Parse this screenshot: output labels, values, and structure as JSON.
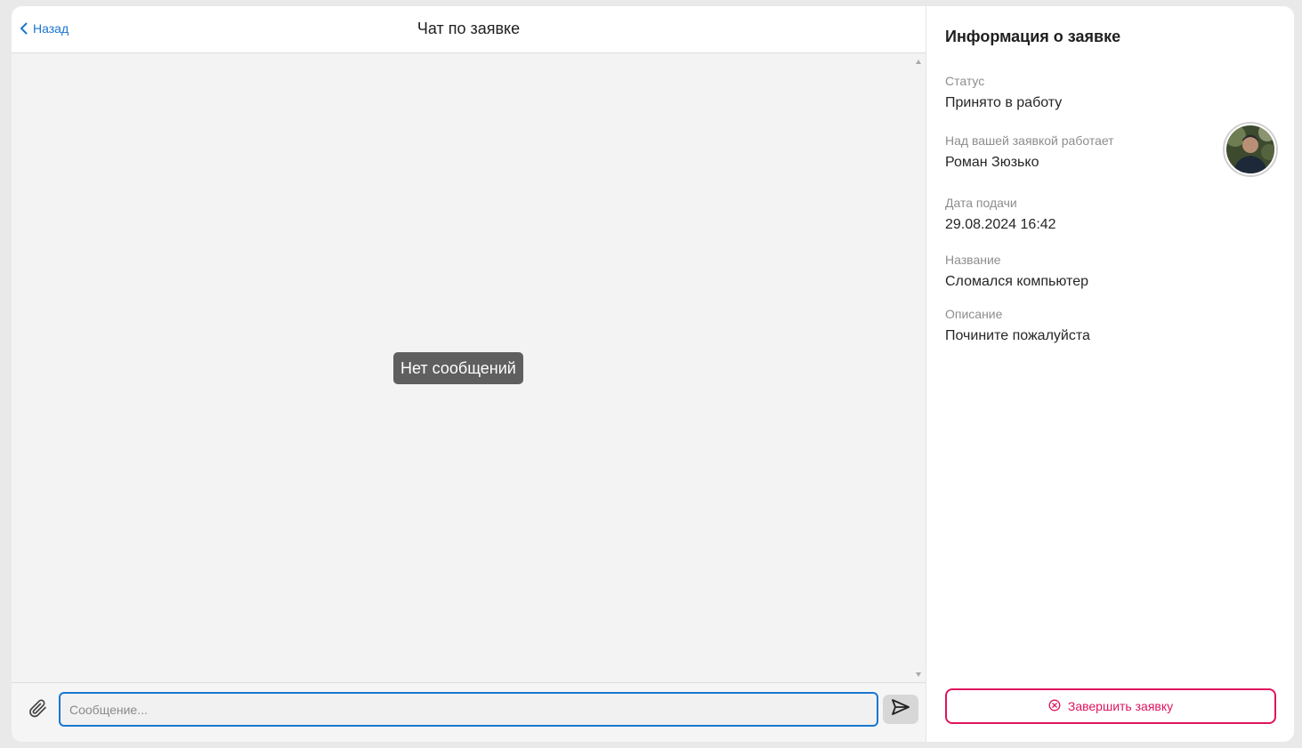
{
  "chat": {
    "back_label": "Назад",
    "title": "Чат по заявке",
    "empty_text": "Нет сообщений",
    "input_placeholder": "Сообщение...",
    "icons": {
      "back": "chevron-left-icon",
      "attach": "paperclip-icon",
      "send": "send-icon"
    }
  },
  "info": {
    "title": "Информация о заявке",
    "fields": [
      {
        "label": "Статус",
        "value": "Принято в работу"
      },
      {
        "label": "Над вашей заявкой работает",
        "value": "Роман Зюзько"
      },
      {
        "label": "Дата подачи",
        "value": "29.08.2024 16:42"
      },
      {
        "label": "Название",
        "value": "Сломался компьютер"
      },
      {
        "label": "Описание",
        "value": "Почините пожалуйста"
      }
    ],
    "finish_label": "Завершить заявку",
    "finish_icon": "close-circle-icon"
  },
  "colors": {
    "accent": "#1976d2",
    "danger": "#e0145d",
    "chat_background": "#f3f3f3",
    "badge_background": "#5f5f5f"
  }
}
